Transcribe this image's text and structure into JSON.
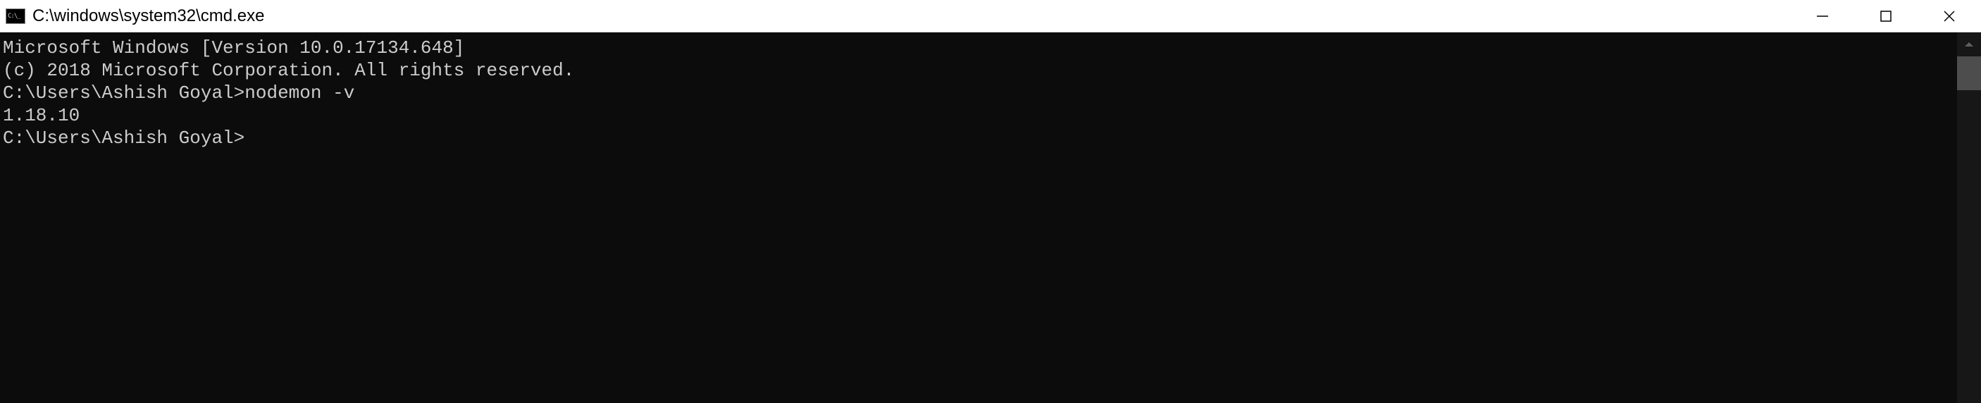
{
  "titlebar": {
    "title": "C:\\windows\\system32\\cmd.exe"
  },
  "terminal": {
    "line1": "Microsoft Windows [Version 10.0.17134.648]",
    "line2": "(c) 2018 Microsoft Corporation. All rights reserved.",
    "blank1": "",
    "prompt1": "C:\\Users\\Ashish Goyal>",
    "command1": "nodemon -v",
    "output1": "1.18.10",
    "blank2": "",
    "prompt2": "C:\\Users\\Ashish Goyal>"
  }
}
